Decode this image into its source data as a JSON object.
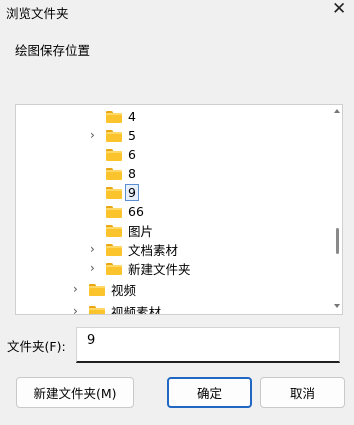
{
  "window": {
    "title": "浏览文件夹",
    "close_glyph": "✕"
  },
  "prompt": "绘图保存位置",
  "tree": {
    "items": [
      {
        "label": "4",
        "expandable": false,
        "selected": false
      },
      {
        "label": "5",
        "expandable": true,
        "selected": false
      },
      {
        "label": "6",
        "expandable": false,
        "selected": false
      },
      {
        "label": "8",
        "expandable": false,
        "selected": false
      },
      {
        "label": "9",
        "expandable": false,
        "selected": true
      },
      {
        "label": "66",
        "expandable": false,
        "selected": false
      },
      {
        "label": "图片",
        "expandable": false,
        "selected": false
      },
      {
        "label": "文档素材",
        "expandable": true,
        "selected": false
      },
      {
        "label": "新建文件夹",
        "expandable": true,
        "selected": false
      },
      {
        "label": "视频",
        "expandable": true,
        "selected": false
      },
      {
        "label": "视频素材",
        "expandable": true,
        "selected": false
      }
    ],
    "chevron_glyph": "›"
  },
  "folder_field": {
    "label": "文件夹(F):",
    "value": "9"
  },
  "buttons": {
    "new_folder": "新建文件夹(M)",
    "ok": "确定",
    "cancel": "取消"
  },
  "colors": {
    "folder": "#fcc42c",
    "selection_border": "#5c8fd1",
    "primary_border": "#2166c3"
  }
}
